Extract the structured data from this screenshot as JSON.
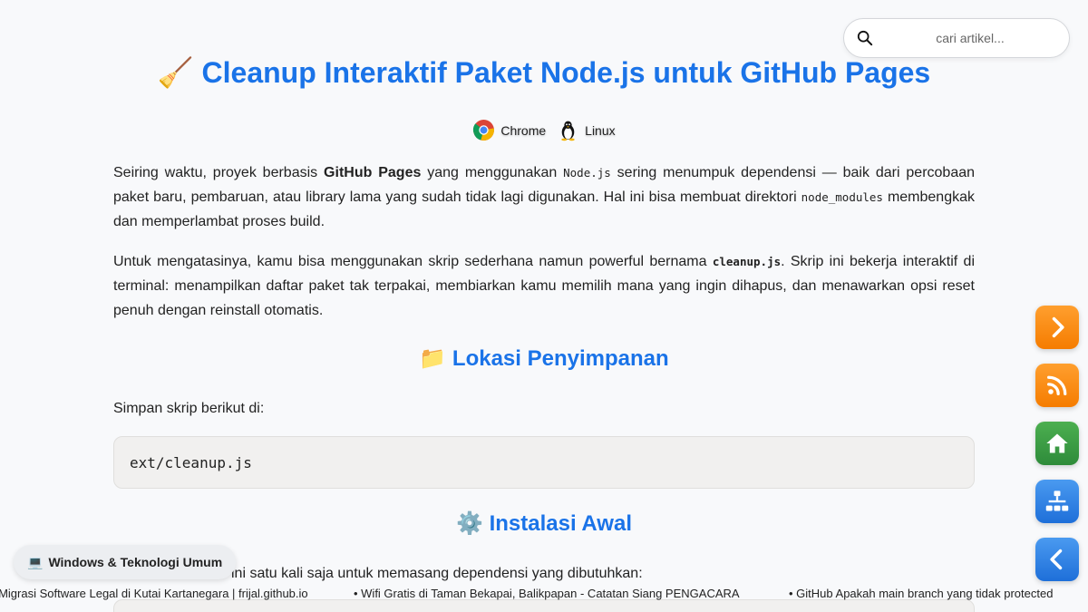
{
  "search": {
    "placeholder": "cari artikel..."
  },
  "article": {
    "title": "Cleanup Interaktif Paket Node.js untuk GitHub Pages",
    "title_emoji": "🧹",
    "platforms": [
      {
        "label": "Chrome",
        "icon": "chrome-icon"
      },
      {
        "label": "Linux",
        "icon": "tux-icon"
      }
    ],
    "p1": {
      "t1": "Seiring waktu, proyek berbasis ",
      "b1": "GitHub Pages",
      "t2": " yang menggunakan ",
      "c1": "Node.js",
      "t3": " sering menumpuk dependensi — baik dari percobaan paket baru, pembaruan, atau library lama yang sudah tidak lagi digunakan. Hal ini bisa membuat direktori ",
      "c2": "node_modules",
      "t4": " membengkak dan memperlambat proses build."
    },
    "p2": {
      "t1": "Untuk mengatasinya, kamu bisa menggunakan skrip sederhana namun powerful bernama ",
      "c1": "cleanup.js",
      "t2": ". Skrip ini bekerja interaktif di terminal: menampilkan daftar paket tak terpakai, membiarkan kamu memilih mana yang ingin dihapus, dan menawarkan opsi reset penuh dengan reinstall otomatis."
    },
    "h2_storage": {
      "emoji": "📁",
      "text": "Lokasi Penyimpanan"
    },
    "p3": "Simpan skrip berikut di:",
    "code_path": "ext/cleanup.js",
    "h2_install": {
      "emoji": "⚙️",
      "text": "Instalasi Awal"
    },
    "p4": "ini satu kali saja untuk memasang dependensi yang dibutuhkan:"
  },
  "category_pill": {
    "emoji": "💻",
    "label": "Windows & Teknologi Umum"
  },
  "ticker": {
    "items": [
      "ah Migrasi Software Legal di Kutai Kartanegara | frijal.github.io",
      "• Wifi Gratis di Taman Bekapai, Balikpapan - Catatan Siang PENGACARA",
      "• GitHub Apakah main branch yang tidak protected"
    ]
  },
  "fabs": [
    {
      "name": "next-button",
      "icon": "chevron-right-icon",
      "color": "#f57c00"
    },
    {
      "name": "rss-button",
      "icon": "rss-icon",
      "color": "#f57c00"
    },
    {
      "name": "home-button",
      "icon": "home-icon",
      "color": "#2e8b3a"
    },
    {
      "name": "sitemap-button",
      "icon": "sitemap-icon",
      "color": "#1e6fd9"
    },
    {
      "name": "prev-button",
      "icon": "chevron-left-icon",
      "color": "#1e6fd9"
    }
  ],
  "colors": {
    "heading": "#1a73e8",
    "background": "#f8f9fb"
  }
}
